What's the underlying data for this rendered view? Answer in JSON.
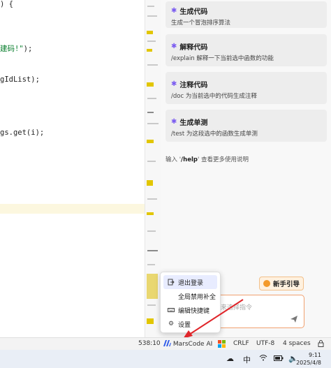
{
  "editor": {
    "lines": [
      {
        "text": ") {",
        "prefix": "",
        "str": "",
        "suffix": ""
      },
      {
        "text": "",
        "prefix": "",
        "str": "建码!\"",
        "suffix": ");"
      },
      {
        "text": "gIdList);",
        "prefix": "",
        "str": "",
        "suffix": ""
      },
      {
        "text": "gs.get(i);",
        "prefix": "",
        "str": "",
        "suffix": ""
      }
    ]
  },
  "panel": {
    "cards": [
      {
        "title": "生成代码",
        "desc": "生成一个冒泡排序算法"
      },
      {
        "title": "解释代码",
        "desc": "/explain 解释一下当前选中函数的功能"
      },
      {
        "title": "注释代码",
        "desc": "/doc 为当前选中的代码生成注释"
      },
      {
        "title": "生成单测",
        "desc": "/test 为这段选中的函数生成单测"
      }
    ],
    "help_prefix": "输入 '",
    "help_cmd": "/help",
    "help_suffix": "' 查看更多使用说明",
    "guide_button": "新手引导",
    "input_placeholder": "来选择指令"
  },
  "menu": {
    "items": [
      {
        "label": "退出登录",
        "icon": "logout-icon"
      },
      {
        "label": "全局禁用补全",
        "icon": ""
      },
      {
        "label": "编辑快捷键",
        "icon": "keyboard-icon"
      },
      {
        "label": "设置",
        "icon": "gear-icon"
      }
    ]
  },
  "statusbar": {
    "position": "538:10",
    "marscode": "MarsCode AI",
    "line_ending": "CRLF",
    "encoding": "UTF-8",
    "indent": "4 spaces"
  },
  "taskbar": {
    "ime": "中",
    "time": "9:11",
    "date": "2025/4/8"
  },
  "colors": {
    "accent": "#7b5cf0",
    "input_border": "#f1a06f",
    "arrow": "#e0262b",
    "guide_bg": "#fff1df"
  }
}
